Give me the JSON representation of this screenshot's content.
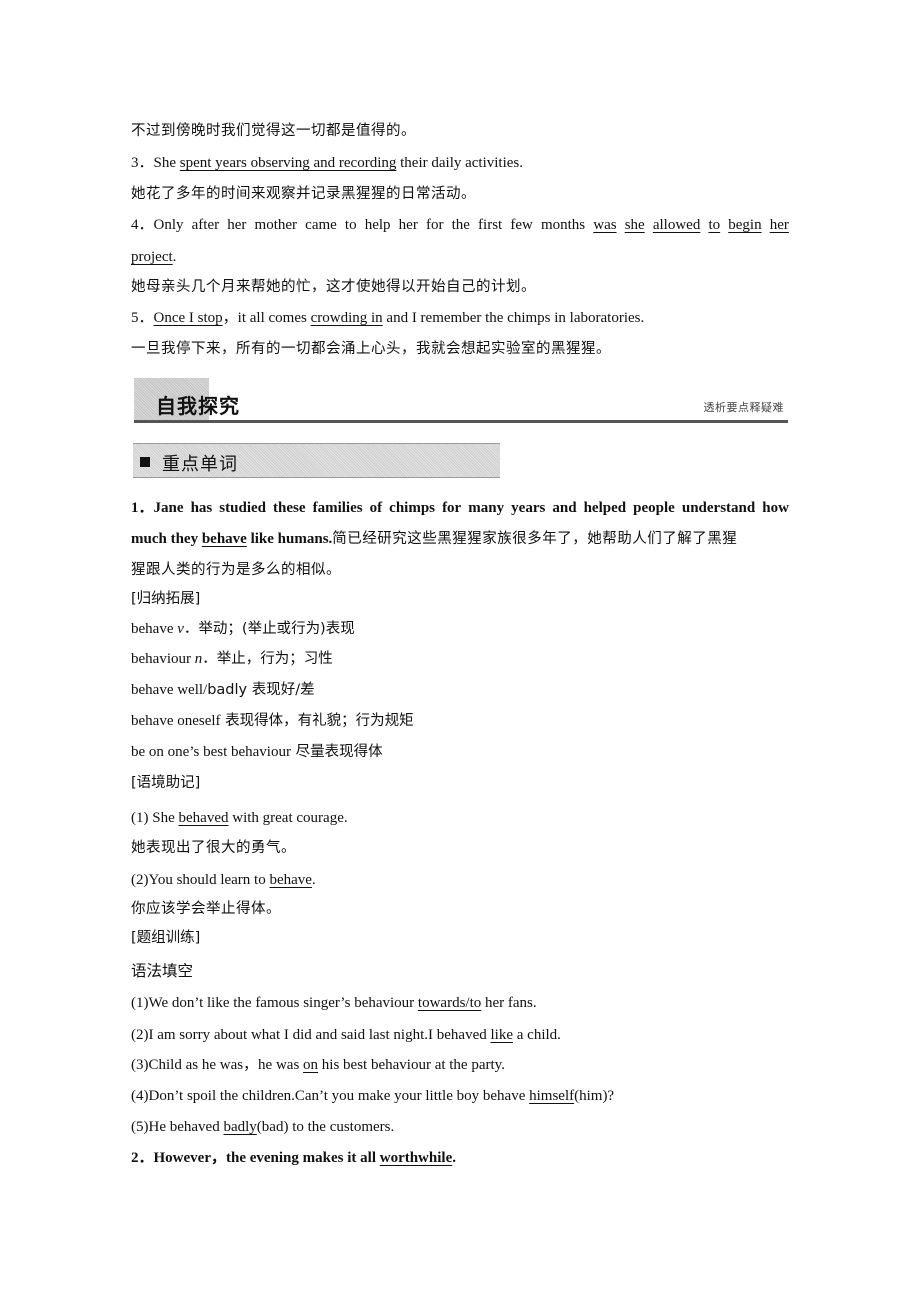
{
  "top_section": {
    "line_0": "不过到傍晚时我们觉得这一切都是值得的。",
    "item3": {
      "num": "3．",
      "pre": "She ",
      "u": "spent years observing and recording",
      "post": " their daily activities.",
      "cn": "她花了多年的时间来观察并记录黑猩猩的日常活动。"
    },
    "item4": {
      "num": "4．",
      "words": [
        "Only",
        "after",
        "her",
        "mother",
        "came",
        "to",
        "help",
        "her",
        "for",
        "the",
        "first",
        "few",
        "months"
      ],
      "u_words": [
        "was",
        "she",
        "allowed",
        "to",
        "begin",
        "her"
      ],
      "u_cont": "project",
      "post": ".",
      "cn": "她母亲头几个月来帮她的忙，这才使她得以开始自己的计划。"
    },
    "item5": {
      "num": "5．",
      "u1": "Once I stop",
      "mid1": "，it all comes ",
      "u2": "crowding in",
      "post": " and I remember the chimps in laboratories.",
      "cn": "一旦我停下来，所有的一切都会涌上心头，我就会想起实验室的黑猩猩。"
    }
  },
  "banner": {
    "title": "自我探究",
    "subtitle": "透析要点释疑难"
  },
  "subsection": {
    "title": "重点单词"
  },
  "word1": {
    "heading_line1_words": [
      "1．Jane",
      "has",
      "studied",
      "these",
      "families",
      "of",
      "chimps",
      "for",
      "many",
      "years",
      "and",
      "helped",
      "people",
      "understand",
      "how"
    ],
    "heading_line2_pre": "much they ",
    "heading_line2_u": "behave",
    "heading_line2_post": " like humans.",
    "heading_line2_cn": "简已经研究这些黑猩猩家族很多年了，她帮助人们了解了黑猩",
    "heading_line3_cn": "猩跟人类的行为是多么的相似。",
    "summary_label": "[归纳拓展]",
    "summary": [
      {
        "en": "behave ",
        "pos": "v",
        "cn": "．举动；(举止或行为)表现"
      },
      {
        "en": "behaviour ",
        "pos": "n",
        "cn": "．举止，行为；习性"
      },
      {
        "en": "behave well/",
        "en2": "badly",
        "cn": " 表现好/差"
      },
      {
        "en": "behave oneself",
        "cn": " 表现得体，有礼貌；行为规矩"
      },
      {
        "en": "be on one’s best behaviour",
        "cn": " 尽量表现得体"
      }
    ],
    "context_label": "[语境助记]",
    "examples": [
      {
        "pre": "(1) She ",
        "u": "behaved",
        "post": " with great courage.",
        "cn": "她表现出了很大的勇气。"
      },
      {
        "pre": "(2)You should learn to ",
        "u": "behave",
        "post": ".",
        "cn": "你应该学会举止得体。"
      }
    ],
    "practice_label": "[题组训练]",
    "exercise_type": "语法填空",
    "exercises": [
      {
        "pre": "(1)We don’t like the famous singer’s behaviour ",
        "u": "towards/to",
        "post": " her fans."
      },
      {
        "pre": "(2)I am sorry about what I did and said last night.I behaved ",
        "u": "like",
        "post": " a child."
      },
      {
        "pre": "(3)Child as he was，he was ",
        "u": "on",
        "post": " his best behaviour at the party."
      },
      {
        "pre": "(4)Don’t spoil the children.Can’t you make your little boy behave ",
        "u": "himself",
        "post": "(him)?"
      },
      {
        "pre": "(5)He behaved ",
        "u": "badly",
        "post": "(bad) to the customers."
      }
    ]
  },
  "word2": {
    "num": "2．",
    "pre": "However，the evening makes it all ",
    "u": "worthwhile",
    "post": "."
  }
}
